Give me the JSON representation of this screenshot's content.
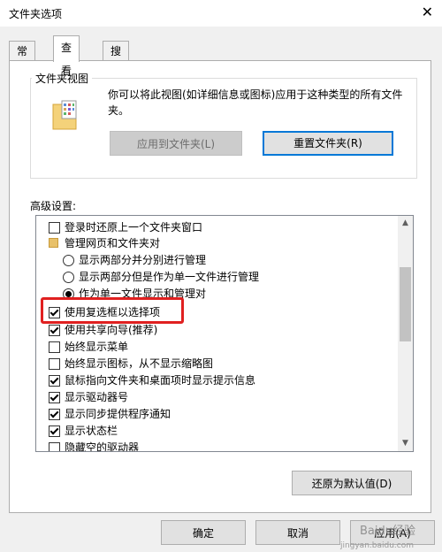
{
  "window": {
    "title": "文件夹选项",
    "close_glyph": "✕"
  },
  "tabs": [
    {
      "label": "常规",
      "active": false
    },
    {
      "label": "查看",
      "active": true
    },
    {
      "label": "搜索",
      "active": false
    }
  ],
  "folder_views": {
    "group_label": "文件夹视图",
    "description": "你可以将此视图(如详细信息或图标)应用于这种类型的所有文件夹。",
    "apply_button": "应用到文件夹(L)",
    "reset_button": "重置文件夹(R)"
  },
  "advanced": {
    "label": "高级设置:",
    "items": [
      {
        "type": "checkbox",
        "checked": false,
        "text": "登录时还原上一个文件夹窗口"
      },
      {
        "type": "folder",
        "text": "管理网页和文件夹对"
      },
      {
        "type": "radio",
        "checked": false,
        "text": "显示两部分并分别进行管理"
      },
      {
        "type": "radio",
        "checked": false,
        "text": "显示两部分但是作为单一文件进行管理"
      },
      {
        "type": "radio",
        "checked": true,
        "text": "作为单一文件显示和管理对"
      },
      {
        "type": "checkbox",
        "checked": true,
        "text": "使用复选框以选择项"
      },
      {
        "type": "checkbox",
        "checked": true,
        "text": "使用共享向导(推荐)"
      },
      {
        "type": "checkbox",
        "checked": false,
        "text": "始终显示菜单"
      },
      {
        "type": "checkbox",
        "checked": false,
        "text": "始终显示图标，从不显示缩略图"
      },
      {
        "type": "checkbox",
        "checked": true,
        "text": "鼠标指向文件夹和桌面项时显示提示信息"
      },
      {
        "type": "checkbox",
        "checked": true,
        "text": "显示驱动器号"
      },
      {
        "type": "checkbox",
        "checked": true,
        "text": "显示同步提供程序通知"
      },
      {
        "type": "checkbox",
        "checked": true,
        "text": "显示状态栏"
      },
      {
        "type": "checkbox",
        "checked": false,
        "text": "隐藏空的驱动器"
      }
    ],
    "restore_defaults_button": "还原为默认值(D)"
  },
  "footer": {
    "ok": "确定",
    "cancel": "取消",
    "apply": "应用(A)"
  },
  "watermark": {
    "main": "Baidu经验",
    "sub": "jingyan.baidu.com"
  },
  "colors": {
    "highlight_box": "#e02020",
    "focus_border": "#0078d7"
  }
}
